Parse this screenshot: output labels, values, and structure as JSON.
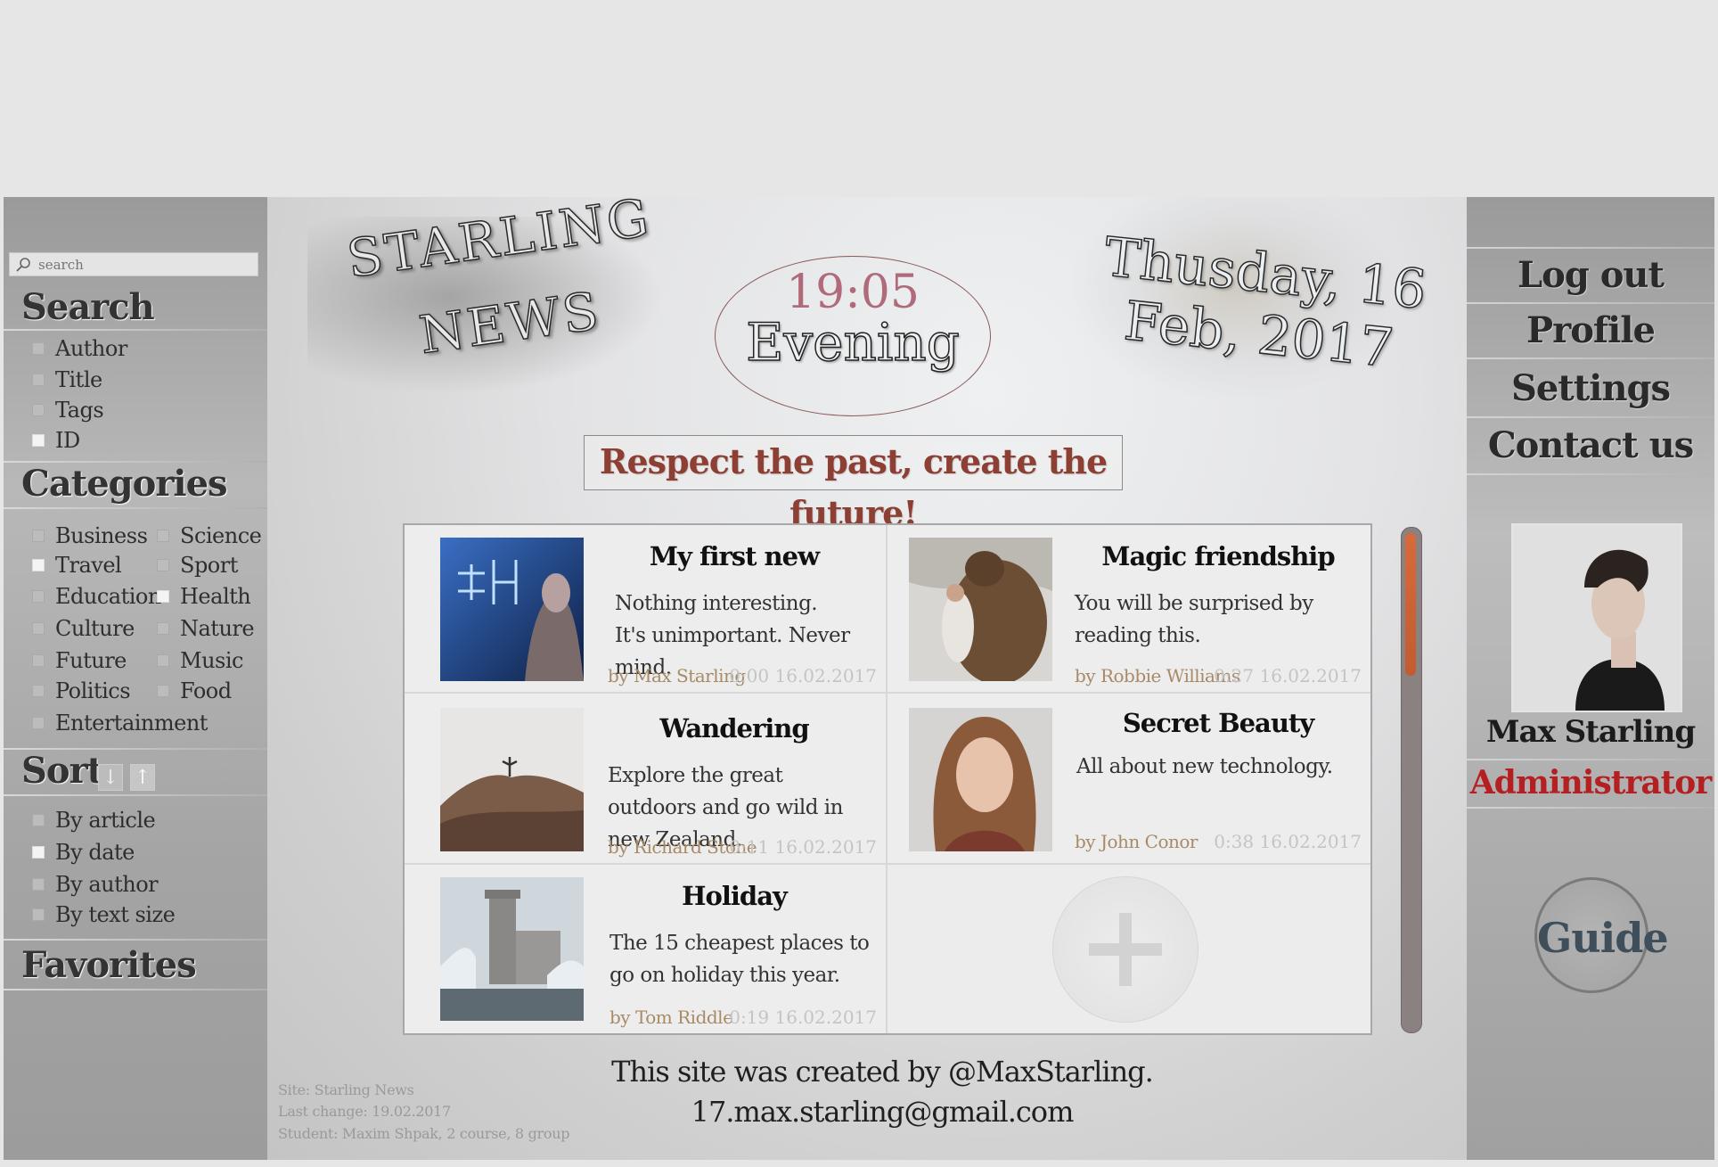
{
  "search": {
    "placeholder": "search"
  },
  "left": {
    "search_title": "Search",
    "search_options": [
      {
        "label": "Author",
        "checked": false
      },
      {
        "label": "Title",
        "checked": false
      },
      {
        "label": "Tags",
        "checked": false
      },
      {
        "label": "ID",
        "checked": true
      }
    ],
    "categories_title": "Categories",
    "categories": [
      {
        "label": "Business",
        "checked": false
      },
      {
        "label": "Science",
        "checked": false
      },
      {
        "label": "Travel",
        "checked": true
      },
      {
        "label": "Sport",
        "checked": false
      },
      {
        "label": "Education",
        "checked": false
      },
      {
        "label": "Health",
        "checked": true
      },
      {
        "label": "Culture",
        "checked": false
      },
      {
        "label": "Nature",
        "checked": false
      },
      {
        "label": "Future",
        "checked": false
      },
      {
        "label": "Music",
        "checked": false
      },
      {
        "label": "Politics",
        "checked": false
      },
      {
        "label": "Food",
        "checked": false
      },
      {
        "label": "Entertainment",
        "checked": false
      }
    ],
    "sort_title": "Sort",
    "sort_options": [
      {
        "label": "By article",
        "checked": false
      },
      {
        "label": "By date",
        "checked": true
      },
      {
        "label": "By author",
        "checked": false
      },
      {
        "label": "By text size",
        "checked": false
      }
    ],
    "favorites_title": "Favorites"
  },
  "header": {
    "logo_line1": "STARLING",
    "logo_line2": "NEWS",
    "time": "19:05",
    "part_of_day": "Evening",
    "date_line1": "Thusday, 16",
    "date_line2": "Feb, 2017",
    "motto": "Respect the past, create the future!"
  },
  "news": [
    {
      "title": "My first new",
      "desc": "Nothing interesting.         It's unimportant. Never mind.",
      "author": "by Max Starling",
      "time": "0:00 16.02.2017"
    },
    {
      "title": "Magic friendship",
      "desc": "You will be surprised by reading this.",
      "author": "by Robbie Williams",
      "time": "0:27 16.02.2017"
    },
    {
      "title": "Wandering",
      "desc": "Explore the great outdoors and go wild in new Zealand.",
      "author": "by Richard Stone",
      "time": "0:11 16.02.2017"
    },
    {
      "title": "Secret Beauty",
      "desc": "All about new technology.",
      "author": "by John Conor",
      "time": "0:38 16.02.2017"
    },
    {
      "title": "Holiday",
      "desc": "The 15 cheapest places to go on holiday this year.",
      "author": "by Tom Riddle",
      "time": "0:19 16.02.2017"
    }
  ],
  "footer": {
    "credit_line1": "This site was created by @MaxStarling.",
    "credit_line2": "17.max.starling@gmail.com",
    "meta_site": "Site: Starling News",
    "meta_change": "Last change: 19.02.2017",
    "meta_student": "Student: Maxim Shpak, 2 course, 8 group"
  },
  "right": {
    "menu": [
      "Log out",
      "Profile",
      "Settings",
      "Contact us"
    ],
    "user_name": "Max  Starling",
    "user_role": "Administrator",
    "guide_label": "Guide"
  },
  "colors": {
    "motto": "#8e3f34",
    "role": "#b51f22",
    "author": "#a88a66",
    "scroll_thumb": "#d86a3a"
  }
}
